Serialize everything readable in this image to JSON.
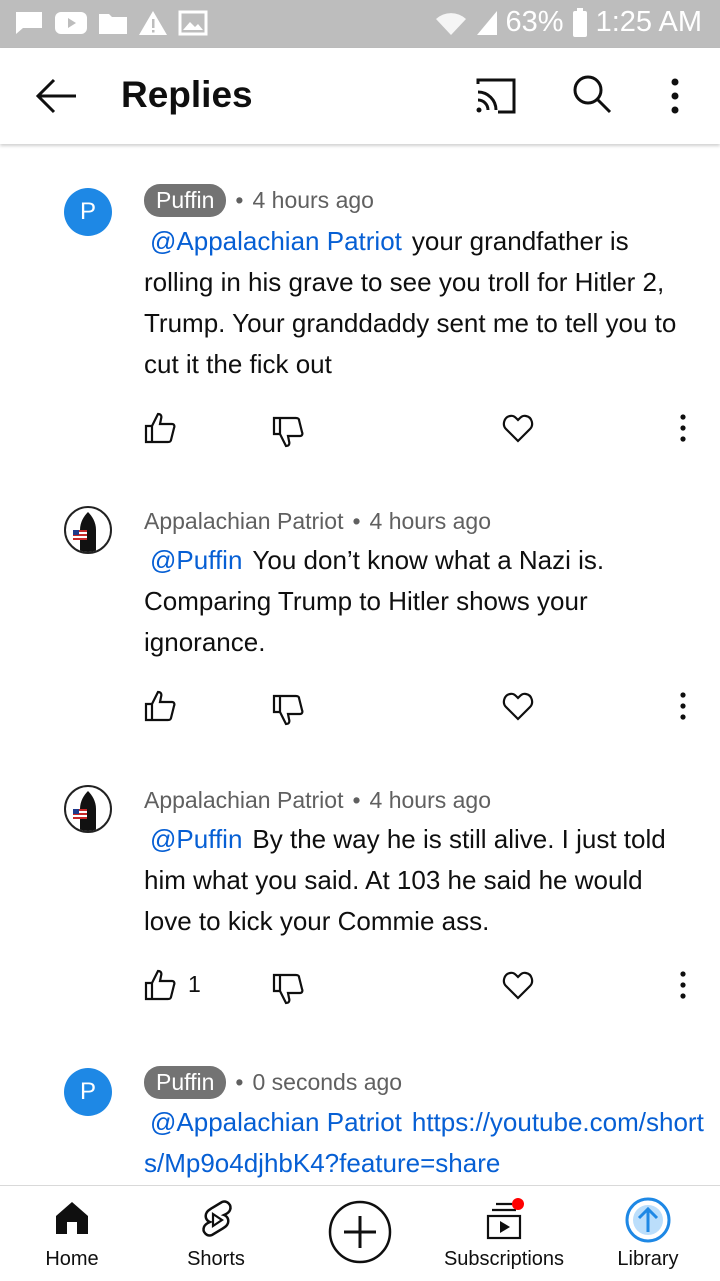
{
  "status_bar": {
    "battery": "63%",
    "time": "1:25 AM"
  },
  "header": {
    "title": "Replies"
  },
  "comments": [
    {
      "avatar_letter": "P",
      "author": "Puffin",
      "separator": "•",
      "time": "4 hours ago",
      "mention": "@Appalachian Patriot",
      "text": "your grandfather is rolling in his grave to see you troll for Hitler 2, Trump. Your granddaddy sent me to tell you to cut it the fick out",
      "likes": ""
    },
    {
      "author": "Appalachian Patriot",
      "separator": "•",
      "time": "4 hours ago",
      "mention": "@Puffin",
      "text": "You don’t know what a Nazi is. Comparing Trump to Hitler shows your ignorance.",
      "likes": ""
    },
    {
      "author": "Appalachian Patriot",
      "separator": "•",
      "time": "4 hours ago",
      "mention": "@Puffin",
      "text": "By the way he is still alive. I just told him what you said. At 103 he said he would love to kick your Commie ass.",
      "likes": "1"
    },
    {
      "avatar_letter": "P",
      "author": "Puffin",
      "separator": "•",
      "time": "0 seconds ago",
      "mention": "@Appalachian Patriot",
      "link": "https://youtube.com/shorts/Mp9o4djhbK4?feature=share"
    }
  ],
  "bottom_nav": {
    "home": "Home",
    "shorts": "Shorts",
    "subscriptions": "Subscriptions",
    "library": "Library"
  },
  "colors": {
    "accent_link": "#065fd4",
    "avatar_blue": "#1e88e5",
    "chip_gray": "#737373",
    "notification_red": "#ff0000",
    "status_bar": "#bdbdbd"
  }
}
